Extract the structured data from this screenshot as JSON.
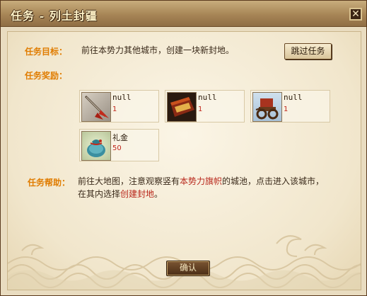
{
  "window": {
    "title": "任务 - 列土封疆",
    "close_label": "✕"
  },
  "task": {
    "objective_label": "任务目标：",
    "objective_text": "前往本势力其他城市，创建一块新封地。",
    "skip_button": "跳过任务",
    "rewards_label": "任务奖励：",
    "rewards": [
      {
        "name": "null",
        "qty": "1",
        "icon": "spear-icon"
      },
      {
        "name": "null",
        "qty": "1",
        "icon": "book-chest-icon"
      },
      {
        "name": "null",
        "qty": "1",
        "icon": "war-chariot-icon"
      },
      {
        "name": "礼金",
        "qty": "50",
        "icon": "money-pouch-icon"
      }
    ],
    "help_label": "任务帮助：",
    "help_line1_a": "前往大地图，注意观察竖有",
    "help_line1_red": "本势力旗帜",
    "help_line1_b": "的城池，点击进入该城市，",
    "help_line2_a": "在其内选择",
    "help_line2_red": "创建封地",
    "help_line2_b": "。",
    "confirm_button": "确认"
  },
  "colors": {
    "label_orange": "#e07c00",
    "highlight_red": "#b8261a",
    "title_text": "#fff3c8"
  }
}
